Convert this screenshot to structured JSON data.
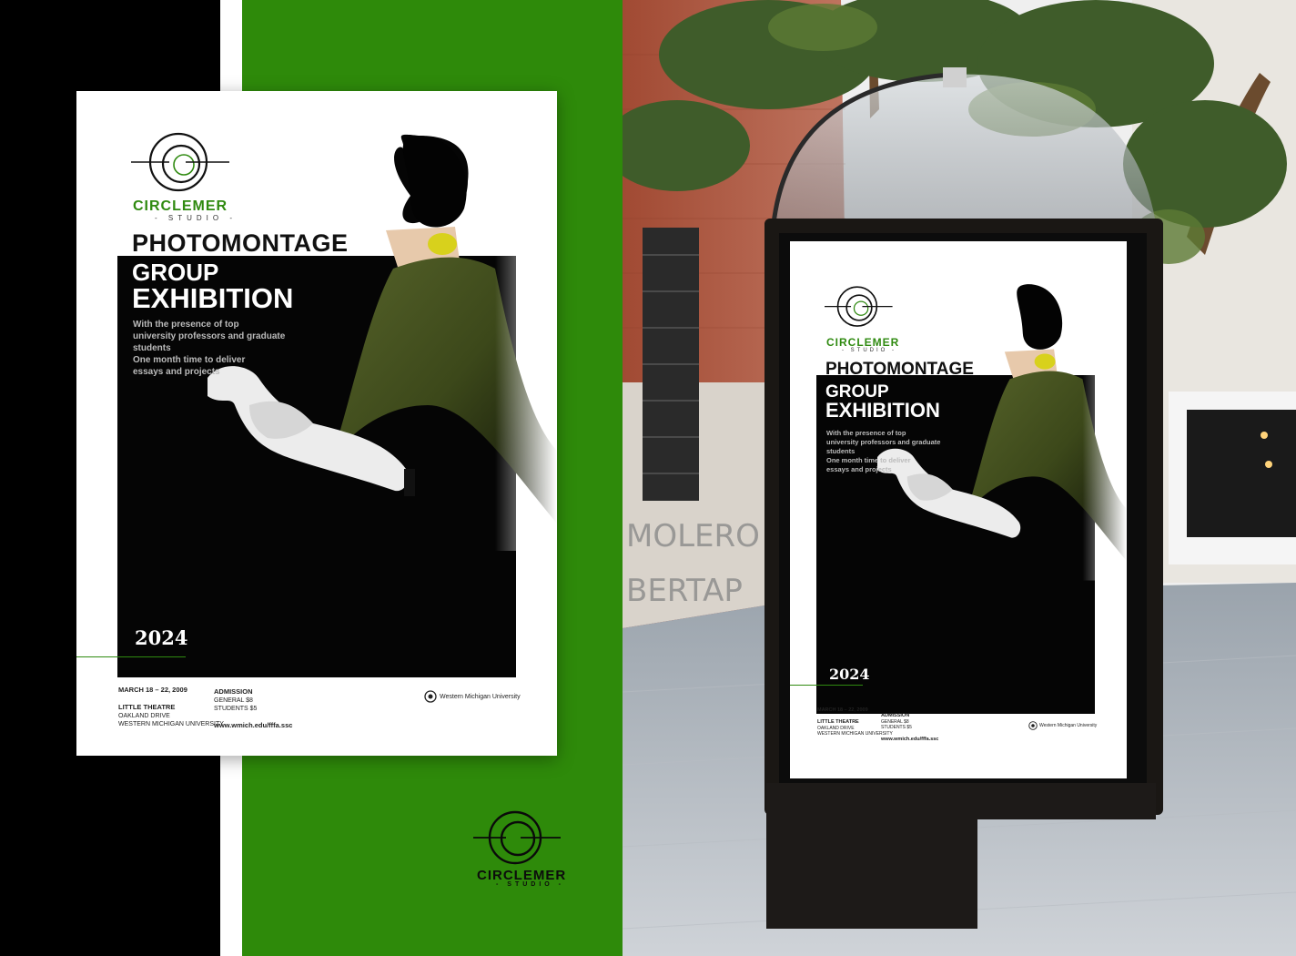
{
  "brand": {
    "name": "CIRCLEMER",
    "sub": "- STUDIO -",
    "accent_color": "#2f8a10",
    "panel_green": "#2e8a0a"
  },
  "poster": {
    "title_line1": "PHOTOMONTAGE",
    "title_line2": "GROUP",
    "title_line3": "EXHIBITION",
    "blurb": [
      "With the presence of top",
      "university professors and graduate",
      "students",
      "One month time to deliver",
      "essays and projects"
    ],
    "year": "2024",
    "dates": "MARCH 18 – 22, 2009",
    "venue_heading": "LITTLE THEATRE",
    "venue_lines": [
      "OAKLAND DRIVE",
      "WESTERN MICHIGAN UNIVERSITY"
    ],
    "admission_heading": "ADMISSION",
    "admission_lines": [
      "GENERAL $8",
      "STUDENTS $5"
    ],
    "url": "www.wmich.edu/fffa.ssc",
    "university": "Western Michigan University"
  },
  "bottom_logo": {
    "name": "CIRCLEMER",
    "sub": "- STUDIO -"
  },
  "photo_scene": {
    "wall_graffiti_1": "MOLERO",
    "wall_graffiti_2": "BERTAP"
  }
}
